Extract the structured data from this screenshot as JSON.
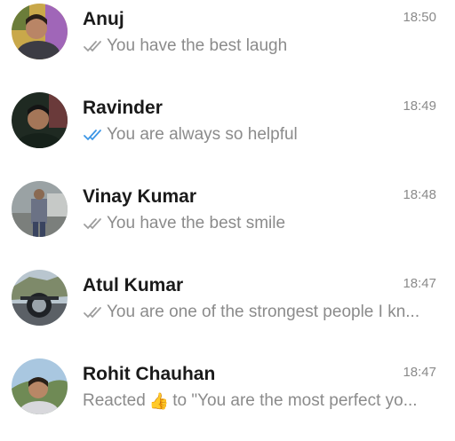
{
  "chats": [
    {
      "name": "Anuj",
      "time": "18:50",
      "preview": "You have the best laugh",
      "status_icon": "double-check-icon",
      "status_color": "#9e9e9e"
    },
    {
      "name": "Ravinder",
      "time": "18:49",
      "preview": "You are always so helpful",
      "status_icon": "double-check-icon",
      "status_color": "#3c96e6"
    },
    {
      "name": "Vinay Kumar",
      "time": "18:48",
      "preview": "You have the best smile",
      "status_icon": "double-check-icon",
      "status_color": "#9e9e9e"
    },
    {
      "name": "Atul Kumar",
      "time": "18:47",
      "preview": "You are one of the strongest people I kn...",
      "status_icon": "double-check-icon",
      "status_color": "#9e9e9e"
    },
    {
      "name": "Rohit Chauhan",
      "time": "18:47",
      "preview_prefix": "Reacted",
      "reaction_emoji": "👍",
      "preview": "to \"You are the most perfect yo...",
      "status_icon": "thumbs-up-emoji"
    }
  ],
  "colors": {
    "read_tick": "#3c96e6",
    "unread_tick": "#9e9e9e",
    "name_text": "#1a1a1a",
    "secondary_text": "#8b8b8b"
  }
}
